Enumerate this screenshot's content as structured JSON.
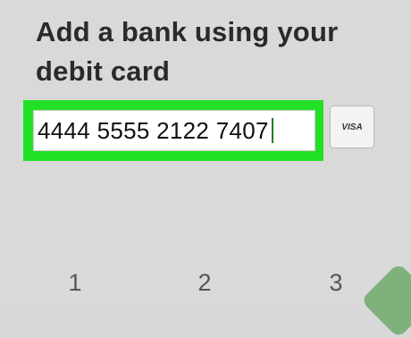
{
  "screen": {
    "heading": "Add a bank using your debit card"
  },
  "card_entry": {
    "value": "4444 5555 2122 7407",
    "brand_label": "VISA",
    "accent_color": "#22e026"
  },
  "keypad": {
    "keys": [
      "1",
      "2",
      "3"
    ]
  },
  "icons": {
    "brand": "visa-card-icon",
    "corner": "next-button-icon"
  }
}
